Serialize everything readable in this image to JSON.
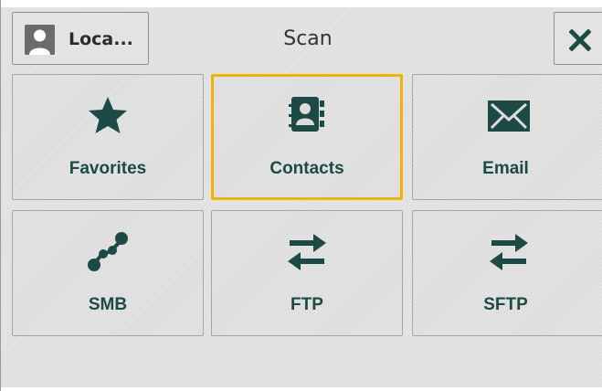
{
  "header": {
    "user_button_label": "Loca...",
    "title": "Scan"
  },
  "tiles": [
    {
      "label": "Favorites",
      "icon": "star-icon"
    },
    {
      "label": "Contacts",
      "icon": "address-book-icon",
      "selected": true
    },
    {
      "label": "Email",
      "icon": "envelope-icon"
    },
    {
      "label": "SMB",
      "icon": "network-nodes-icon"
    },
    {
      "label": "FTP",
      "icon": "transfer-arrows-icon"
    },
    {
      "label": "SFTP",
      "icon": "transfer-arrows-icon"
    }
  ],
  "colors": {
    "accent": "#1e4a45",
    "selection": "#f0b400"
  }
}
